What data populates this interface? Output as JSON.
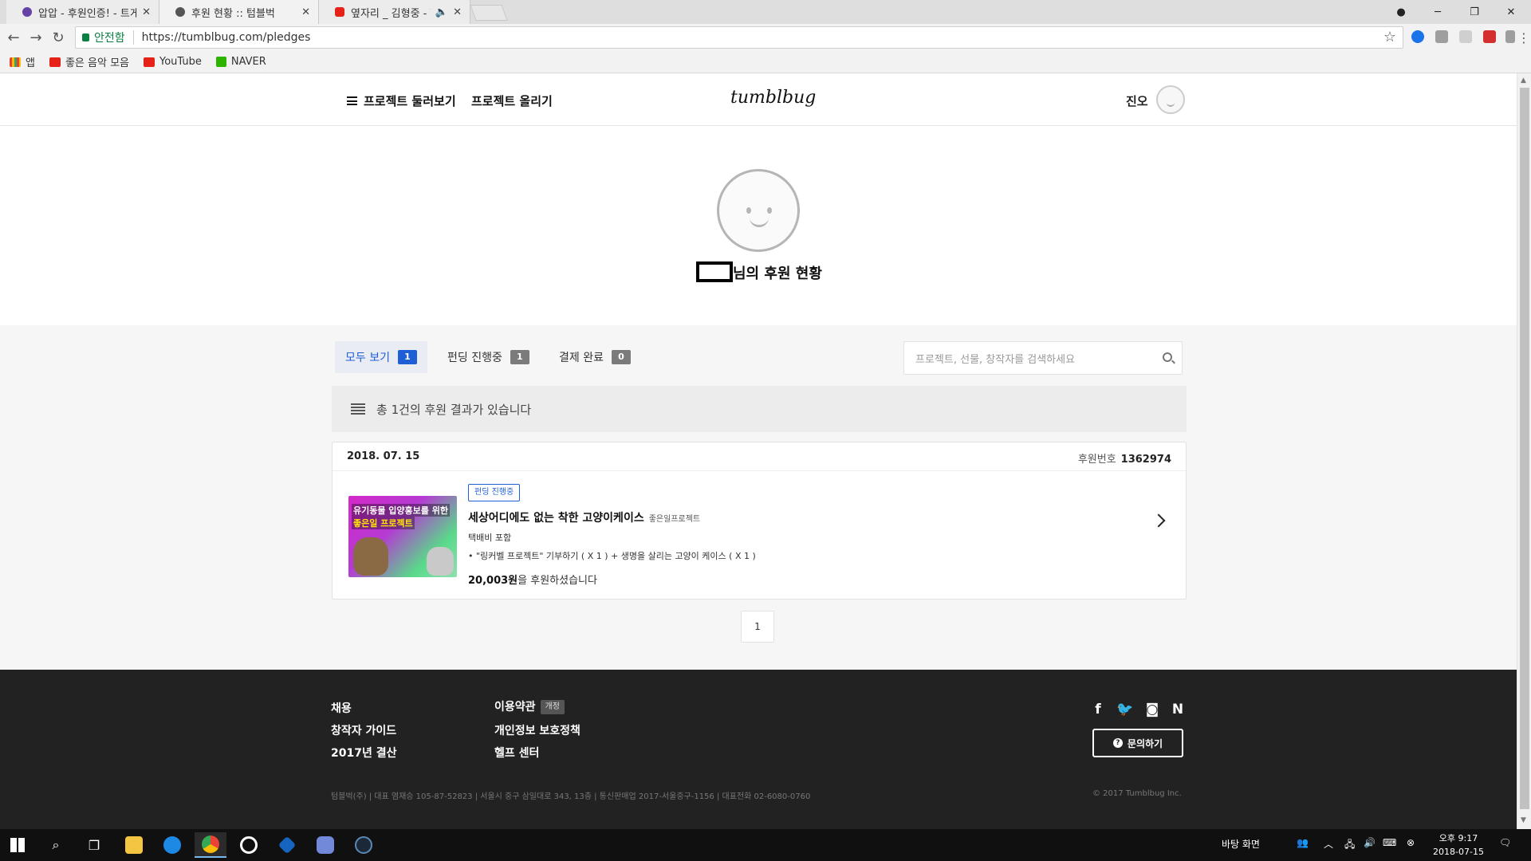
{
  "browser": {
    "tabs": [
      {
        "title": "압압 - 후원인증! - 트게더",
        "favicon_color": "#6441a5"
      },
      {
        "title": "후원 현황 :: 텀블벅",
        "favicon_color": "#555555"
      },
      {
        "title": "옆자리 _ 김형중 - YouTube",
        "favicon_color": "#e62117"
      }
    ],
    "security_label": "안전함",
    "url": "https://tumblbug.com/pledges",
    "bookmarks": [
      {
        "label": "앱",
        "color": "#e94235"
      },
      {
        "label": "좋은 음악 모음",
        "color": "#e62117"
      },
      {
        "label": "YouTube",
        "color": "#e62117"
      },
      {
        "label": "NAVER",
        "color": "#2db400"
      }
    ]
  },
  "header": {
    "browse_label": "프로젝트 둘러보기",
    "upload_label": "프로젝트 올리기",
    "logo": "tumblbug",
    "username": "진오"
  },
  "profile": {
    "title_suffix": "님의 후원 현황"
  },
  "filters": [
    {
      "label": "모두 보기",
      "count": "1"
    },
    {
      "label": "펀딩 진행중",
      "count": "1"
    },
    {
      "label": "결제 완료",
      "count": "0"
    }
  ],
  "search": {
    "placeholder": "프로젝트, 선물, 창작자를 검색하세요"
  },
  "summary": "총 1건의 후원 결과가 있습니다",
  "pledge": {
    "date": "2018. 07. 15",
    "number_label": "후원번호",
    "number": "1362974",
    "status": "펀딩 진행중",
    "title": "세상어디에도 없는 착한 고양이케이스",
    "creator": "좋은일프로젝트",
    "shipping": "택배비 포함",
    "rewards": "• \"링커벨 프로젝트\" 기부하기 ( X 1 ) + 생명을 살리는 고양이 케이스 ( X 1 )",
    "amount": "20,003원",
    "amount_suffix": "을 후원하셨습니다",
    "thumb_line1": "유기동물 입양홍보를 위한",
    "thumb_line2": "좋은일 프로젝트"
  },
  "pagination": {
    "current": "1"
  },
  "footer": {
    "col1": [
      "채용",
      "창작자 가이드",
      "2017년 결산"
    ],
    "col2": [
      "이용약관",
      "개인정보 보호정책",
      "헬프 센터"
    ],
    "terms_badge": "개정",
    "inquiry": "문의하기",
    "company_info": "텀블벅(주) | 대표 염재승 105-87-52823 | 서울시 중구 삼일대로 343, 13층 | 통신판매업 2017-서울중구-1156 | 대표전화 02-6080-0760",
    "copyright": "© 2017 Tumblbug Inc."
  },
  "taskbar": {
    "desktop_label": "바탕 화면",
    "time": "오후 9:17",
    "date": "2018-07-15"
  }
}
